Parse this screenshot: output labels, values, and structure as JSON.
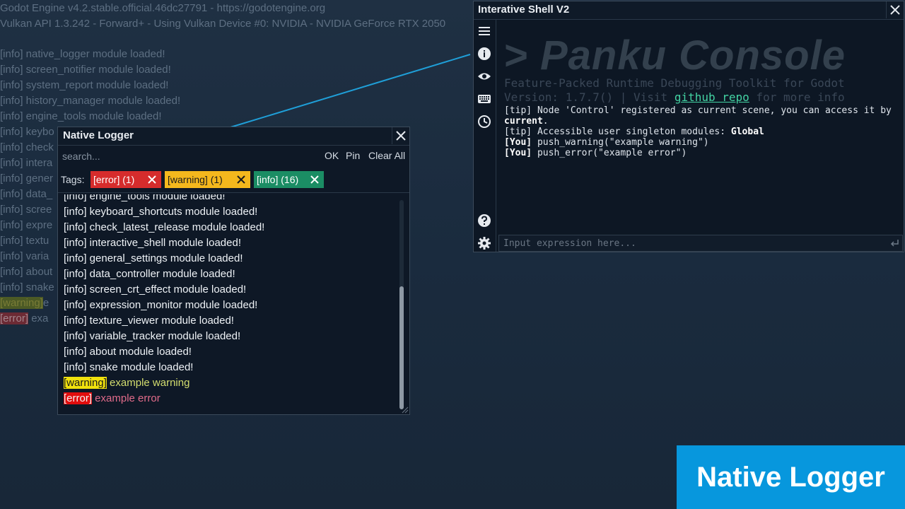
{
  "background_console": {
    "header_lines": [
      "Godot Engine v4.2.stable.official.46dc27791 - https://godotengine.org",
      "Vulkan API 1.3.242 - Forward+ - Using Vulkan Device #0: NVIDIA - NVIDIA GeForce RTX 2050"
    ],
    "visible_lines": [
      "[info] native_logger module loaded!",
      "[info] screen_notifier module loaded!",
      "[info] system_report module loaded!",
      "[info] history_manager module loaded!",
      "[info] engine_tools module loaded!",
      "[info] keybo",
      "[info] check",
      "[info] intera",
      "[info] gener",
      "[info] data_",
      "[info] scree",
      "[info] expre",
      "[info] textu",
      "[info] varia",
      "[info] about",
      "[info] snake"
    ],
    "warning_tag": "[warning]",
    "warning_msg": "e",
    "error_tag": "[error]",
    "error_msg": "exa"
  },
  "native_logger": {
    "title": "Native Logger",
    "search_placeholder": "search...",
    "ok_label": "OK",
    "pin_label": "Pin",
    "clear_all_label": "Clear All",
    "tags_label": "Tags:",
    "tags": {
      "error": "[error] (1)",
      "warning": "[warning] (1)",
      "info": "[info] (16)"
    },
    "lines": [
      "[info] engine_tools module loaded!",
      "[info] keyboard_shortcuts module loaded!",
      "[info] check_latest_release module loaded!",
      "[info] interactive_shell module loaded!",
      "[info] general_settings module loaded!",
      "[info] data_controller module loaded!",
      "[info] screen_crt_effect module loaded!",
      "[info] expression_monitor module loaded!",
      "[info] texture_viewer module loaded!",
      "[info] variable_tracker module loaded!",
      "[info] about module loaded!",
      "[info] snake module loaded!"
    ],
    "warning_tag": "[warning]",
    "warning_msg": " example warning",
    "error_tag": "[error]",
    "error_msg": " example error"
  },
  "shell": {
    "title": "Interative Shell V2",
    "logo": "> Panku Console",
    "subtitle": "Feature-Packed Runtime Debugging Toolkit for Godot",
    "version_prefix": "Version: 1.7.7() | Visit ",
    "repo_link": "github repo",
    "version_suffix": " for more info",
    "output": {
      "tip1_prefix": "[tip] Node 'Control' registered as current scene, you can access it by",
      "tip1_bold": "current",
      "tip1_end": ".",
      "tip2_prefix": "[tip] Accessible user singleton modules: ",
      "tip2_bold": "Global",
      "you1_label": "[You]",
      "you1_text": " push_warning(\"example warning\")",
      "you2_label": "[You]",
      "you2_text": " push_error(\"example error\")"
    },
    "input_placeholder": "Input expression here...",
    "side_icons": [
      "menu-icon",
      "info-icon",
      "eye-icon",
      "keyboard-icon",
      "history-icon",
      "help-icon",
      "settings-icon"
    ]
  },
  "banner": {
    "text": "Native Logger"
  },
  "colors": {
    "error": "#d62c2c",
    "warning": "#f4b81d",
    "info": "#1b8d64",
    "link": "#43d3a3",
    "banner": "#0797dd",
    "connector": "#1f9fd8"
  }
}
